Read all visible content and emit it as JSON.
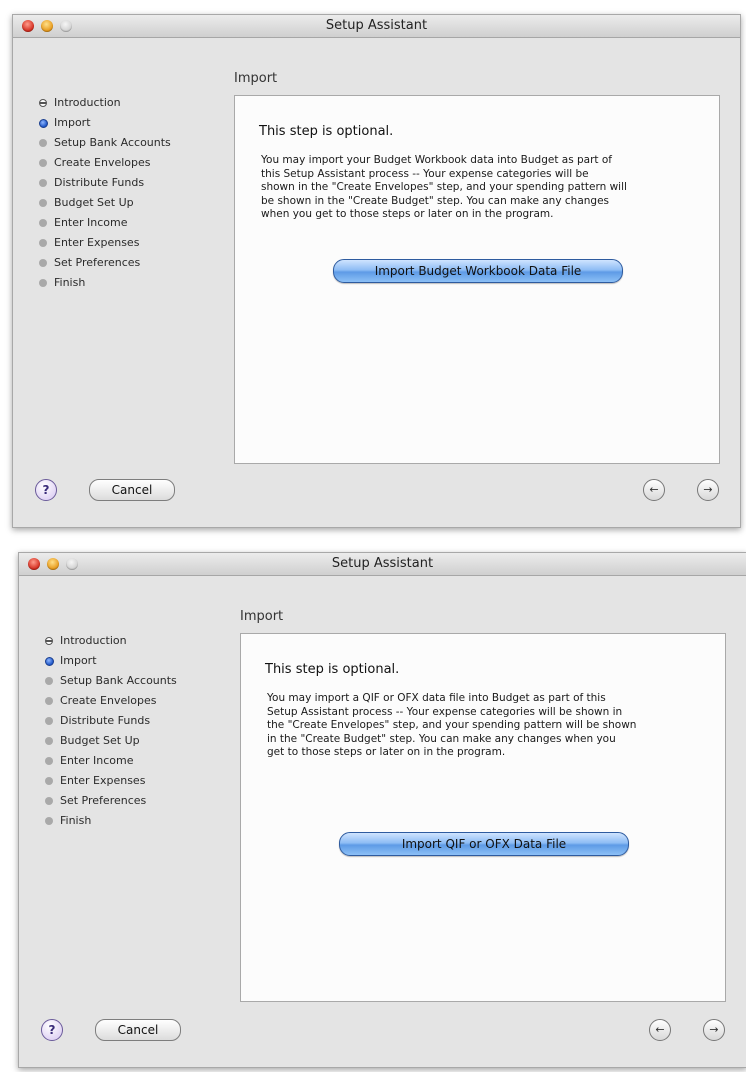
{
  "windows": [
    {
      "title": "Setup Assistant",
      "section_title": "Import",
      "steps": [
        "Introduction",
        "Import",
        "Setup Bank Accounts",
        "Create Envelopes",
        "Distribute Funds",
        "Budget Set Up",
        "Enter Income",
        "Enter Expenses",
        "Set Preferences",
        "Finish"
      ],
      "lead": "This step is optional.",
      "body_lines": [
        "You may import your Budget Workbook data into Budget as part of",
        "this Setup Assistant process -- Your expense categories will be",
        "shown in the \"Create Envelopes\" step, and your spending pattern will",
        "be shown in the \"Create Budget\" step.  You can make any changes",
        "when you get to those steps or later on in the program."
      ],
      "import_button": "Import Budget Workbook Data File",
      "help_label": "?",
      "cancel_label": "Cancel",
      "back_icon": "back-arrow-icon",
      "next_icon": "forward-arrow-icon"
    },
    {
      "title": "Setup Assistant",
      "section_title": "Import",
      "steps": [
        "Introduction",
        "Import",
        "Setup Bank Accounts",
        "Create Envelopes",
        "Distribute Funds",
        "Budget Set Up",
        "Enter Income",
        "Enter Expenses",
        "Set Preferences",
        "Finish"
      ],
      "lead": "This step is optional.",
      "body_lines": [
        "You may import a QIF or OFX data file into Budget as part of this",
        "Setup Assistant process -- Your expense categories will be shown in",
        "the \"Create Envelopes\" step, and your spending pattern will be shown",
        "in the \"Create Budget\" step.  You can make any changes when you",
        "get to those steps or later on in the program."
      ],
      "import_button": "Import QIF or OFX Data File",
      "help_label": "?",
      "cancel_label": "Cancel",
      "back_icon": "back-arrow-icon",
      "next_icon": "forward-arrow-icon"
    }
  ]
}
